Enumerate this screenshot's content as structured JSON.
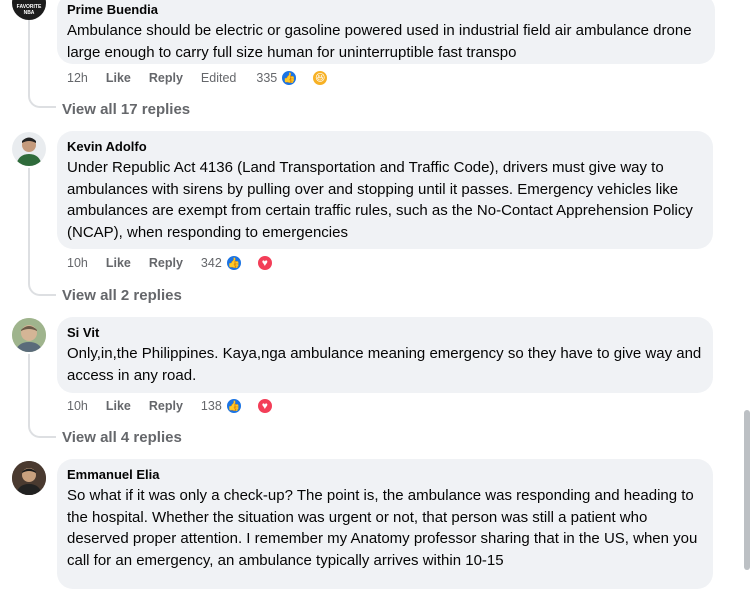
{
  "comments": [
    {
      "author": "Prime Buendia",
      "avatar_label": "FAVORITE NBA",
      "text": "Ambulance should be electric or gasoline powered used in industrial field air ambulance drone large enough to carry full size human for uninterruptible fast transpo",
      "time": "12h",
      "like": "Like",
      "reply": "Reply",
      "edited": "Edited",
      "reaction_count": "335",
      "reactions": [
        "like-icon",
        "haha-icon"
      ],
      "view_replies": "View all 17 replies"
    },
    {
      "author": "Kevin Adolfo",
      "text": "Under Republic Act 4136 (Land Transportation and Traffic Code), drivers must give way to ambulances with sirens by pulling over and stopping until it passes. Emergency vehicles like ambulances are exempt from certain traffic rules, such as the No-Contact Apprehension Policy (NCAP), when responding to emergencies",
      "time": "10h",
      "like": "Like",
      "reply": "Reply",
      "reaction_count": "342",
      "reactions": [
        "like-icon",
        "love-icon"
      ],
      "view_replies": "View all 2 replies"
    },
    {
      "author": "Si Vit",
      "text": "Only,in,the Philippines. Kaya,nga ambulance meaning emergency so they have to give way and access in any road.",
      "time": "10h",
      "like": "Like",
      "reply": "Reply",
      "reaction_count": "138",
      "reactions": [
        "like-icon",
        "love-icon"
      ],
      "view_replies": "View all 4 replies"
    },
    {
      "author": "Emmanuel Elia",
      "text": "So what if it was only a check-up? The point is, the ambulance was responding and heading to the hospital. Whether the situation was urgent or not, that person was still a patient who deserved proper attention. I remember my Anatomy professor sharing that in the US, when you call for an emergency, an ambulance typically arrives within 10-15"
    }
  ],
  "colors": {
    "bubble": "#f0f2f5",
    "meta": "#65676b",
    "like": "#1b74e4",
    "love": "#f33e58",
    "haha": "#f7b125"
  }
}
